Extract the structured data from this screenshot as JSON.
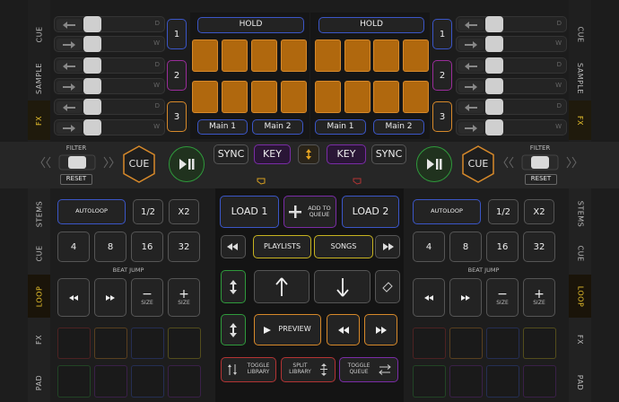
{
  "left_tabs_top": [
    {
      "label": "CUE"
    },
    {
      "label": "SAMPLE"
    },
    {
      "label": "FX",
      "active": true
    }
  ],
  "right_tabs_top": [
    {
      "label": "CUE"
    },
    {
      "label": "SAMPLE"
    },
    {
      "label": "FX",
      "active": true
    }
  ],
  "left_tabs_bottom": [
    {
      "label": "STEMS"
    },
    {
      "label": "CUE"
    },
    {
      "label": "LOOP",
      "active": true
    },
    {
      "label": "FX"
    },
    {
      "label": "PAD"
    }
  ],
  "right_tabs_bottom": [
    {
      "label": "STEMS"
    },
    {
      "label": "CUE"
    },
    {
      "label": "LOOP",
      "active": true
    },
    {
      "label": "FX"
    },
    {
      "label": "PAD"
    }
  ],
  "fader_rows": [
    {
      "key_label": "D",
      "knob_level": 0.0
    },
    {
      "key_label": "W",
      "knob_level": 0.0
    },
    {
      "key_label": "D",
      "knob_level": 0.0
    },
    {
      "key_label": "W",
      "knob_level": 0.0
    },
    {
      "key_label": "D",
      "knob_level": 0.0
    },
    {
      "key_label": "W",
      "knob_level": 0.0
    }
  ],
  "fx_units": [
    "1",
    "2",
    "3"
  ],
  "deck_left": {
    "hold": "HOLD",
    "main1": "Main 1",
    "main2": "Main 2"
  },
  "deck_right": {
    "hold": "HOLD",
    "main1": "Main 1",
    "main2": "Main 2"
  },
  "filter_label": "FILTER",
  "reset_label": "RESET",
  "cue_label": "CUE",
  "sync_label": "SYNC",
  "key_label": "KEY",
  "loop": {
    "autoloop": "AUTOLOOP",
    "half": "1/2",
    "double": "X2",
    "sizes": [
      "4",
      "8",
      "16",
      "32"
    ],
    "beat_jump": "BEAT JUMP",
    "size_label": "SIZE"
  },
  "browser": {
    "load1": "LOAD 1",
    "add_to_queue": "ADD TO QUEUE",
    "load2": "LOAD 2",
    "playlists": "PLAYLISTS",
    "songs": "SONGS",
    "preview": "PREVIEW",
    "toggle_library": "TOGGLE LIBRARY",
    "split_library": "SPLIT LIBRARY",
    "toggle_queue": "TOGGLE QUEUE"
  },
  "colors": {
    "orange": "#d7892a",
    "purple": "#7a2ca6",
    "blue": "#3b56c7",
    "green": "#2f9a3c",
    "yellow": "#c7b320",
    "red": "#b33434"
  }
}
